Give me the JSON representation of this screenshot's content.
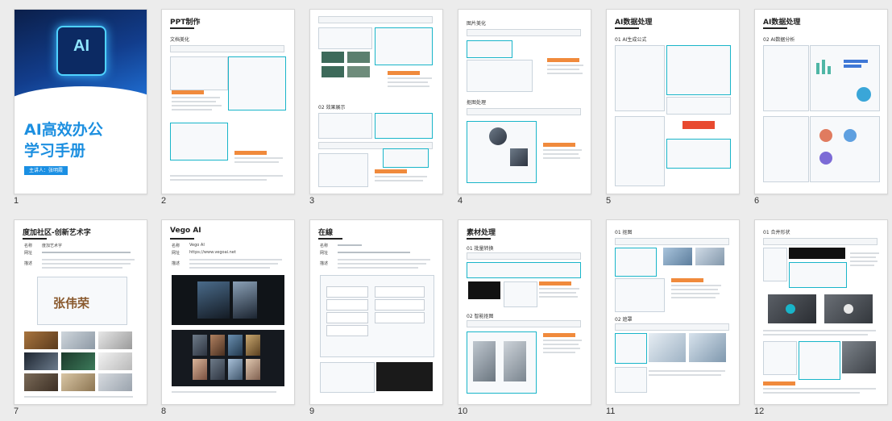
{
  "pages": [
    {
      "num": "1",
      "title_line1": "AI高效办公",
      "title_line2": "学习手册",
      "author": "主讲人：张明霞",
      "chip_text": "AI"
    },
    {
      "num": "2",
      "title": "PPT制作",
      "section": "文档美化"
    },
    {
      "num": "3",
      "title": "",
      "section": "02 效果展示"
    },
    {
      "num": "4",
      "title": "",
      "section": "图片美化",
      "section2": "抠图处理"
    },
    {
      "num": "5",
      "title": "AI数据处理",
      "section": "01 AI生成公式"
    },
    {
      "num": "6",
      "title": "AI数据处理",
      "section": "02 AI数据分析"
    },
    {
      "num": "7",
      "title": "度加社区-创新艺术字",
      "row1_key": "名称",
      "row1_val": "度加艺术字",
      "row2_key": "网址",
      "row3_key": "描述",
      "art_text": "张伟荣"
    },
    {
      "num": "8",
      "title": "Vego AI",
      "row1_key": "名称",
      "row1_val": "Vego AI",
      "row2_key": "网址",
      "row2_val": "https://www.vegoai.net",
      "row3_key": "描述"
    },
    {
      "num": "9",
      "title": "在線",
      "row1_key": "名称",
      "row2_key": "网址",
      "row3_key": "描述"
    },
    {
      "num": "10",
      "title": "素材处理",
      "section": "01 批量转换",
      "section2": "02 智能抠图"
    },
    {
      "num": "11",
      "title": "",
      "section": "01 抠图",
      "section2": "02 遮罩"
    },
    {
      "num": "12",
      "title": "",
      "section": "01 合并形状"
    }
  ],
  "colors": {
    "accent": "#19b5c9",
    "cover_blue": "#1c8fe0",
    "orange": "#f08a3c"
  }
}
